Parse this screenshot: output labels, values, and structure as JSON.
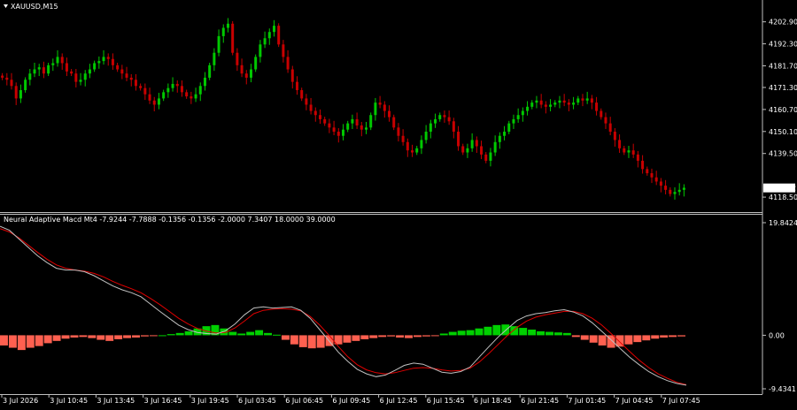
{
  "chart_data": [
    {
      "type": "candlestick",
      "title": "XAUUSD,M15",
      "ylim": [
        4113.0,
        4210.0
      ],
      "y_ticks": [
        "4202.90",
        "4192.30",
        "4181.70",
        "4171.30",
        "4160.70",
        "4150.10",
        "4139.50",
        "4118.50"
      ],
      "y_tick_values": [
        4202.9,
        4192.3,
        4181.7,
        4171.3,
        4160.7,
        4150.1,
        4139.5,
        4118.5
      ],
      "current_price": "4122.92",
      "current_price_value": 4122.92,
      "up_color": "#00c800",
      "down_color": "#c80000",
      "close_series": [
        4176,
        4175,
        4172,
        4166,
        4170,
        4175,
        4178,
        4180,
        4181,
        4178,
        4182,
        4183,
        4186,
        4183,
        4179,
        4178,
        4174,
        4175,
        4178,
        4180,
        4183,
        4184,
        4186,
        4185,
        4182,
        4180,
        4178,
        4176,
        4175,
        4172,
        4171,
        4168,
        4165,
        4163,
        4166,
        4169,
        4171,
        4173,
        4172,
        4169,
        4167,
        4166,
        4168,
        4172,
        4176,
        4182,
        4188,
        4196,
        4200,
        4202,
        4188,
        4182,
        4178,
        4176,
        4180,
        4186,
        4192,
        4195,
        4198,
        4201,
        4192,
        4186,
        4180,
        4174,
        4170,
        4166,
        4163,
        4160,
        4158,
        4156,
        4154,
        4152,
        4150,
        4148,
        4151,
        4154,
        4156,
        4153,
        4151,
        4152,
        4158,
        4164,
        4163,
        4160,
        4157,
        4152,
        4148,
        4145,
        4141,
        4140,
        4142,
        4146,
        4150,
        4154,
        4156,
        4158,
        4157,
        4155,
        4150,
        4143,
        4140,
        4142,
        4146,
        4143,
        4139,
        4136,
        4140,
        4145,
        4148,
        4150,
        4154,
        4156,
        4158,
        4160,
        4162,
        4164,
        4165,
        4163,
        4162,
        4163,
        4164,
        4165,
        4164,
        4163,
        4164,
        4166,
        4165,
        4166,
        4164,
        4160,
        4157,
        4154,
        4150,
        4146,
        4142,
        4140,
        4141,
        4139,
        4136,
        4132,
        4130,
        4128,
        4126,
        4124,
        4122,
        4120,
        4121,
        4122,
        4123
      ]
    },
    {
      "type": "line",
      "title": "Neural Adaptive Macd Mt4 -7.9244 -7.7888 -0.1356 -0.1356 -2.0000 7.3407 18.0000 39.0000",
      "ylim": [
        -9.4341,
        19.8424
      ],
      "y_ticks": [
        "19.8424",
        "0.00",
        "-9.4341"
      ],
      "y_tick_values": [
        19.8424,
        0.0,
        -9.4341
      ],
      "series": [
        {
          "name": "",
          "color": "#c0c0c0",
          "values": [
            19.2,
            18.5,
            17.0,
            15.5,
            14.0,
            12.8,
            11.8,
            11.5,
            11.5,
            11.2,
            10.5,
            9.6,
            8.7,
            8.0,
            7.5,
            6.8,
            5.5,
            4.2,
            3.0,
            1.8,
            1.0,
            0.5,
            0.3,
            0.2,
            0.8,
            2.0,
            3.6,
            4.8,
            5.0,
            4.8,
            4.9,
            5.0,
            4.4,
            3.0,
            1.0,
            -1.0,
            -3.0,
            -4.6,
            -6.0,
            -6.8,
            -7.3,
            -7.0,
            -6.2,
            -5.3,
            -4.9,
            -5.1,
            -5.8,
            -6.5,
            -6.7,
            -6.4,
            -5.6,
            -3.8,
            -2.0,
            -0.3,
            1.2,
            2.6,
            3.4,
            3.8,
            4.0,
            4.3,
            4.5,
            4.1,
            3.4,
            2.2,
            0.7,
            -0.8,
            -2.4,
            -3.9,
            -5.2,
            -6.4,
            -7.3,
            -8.0,
            -8.5,
            -8.8
          ]
        },
        {
          "name": "",
          "color": "#e00000",
          "values": [
            18.8,
            18.2,
            17.2,
            15.9,
            14.6,
            13.4,
            12.4,
            11.8,
            11.5,
            11.3,
            10.9,
            10.3,
            9.5,
            8.8,
            8.2,
            7.5,
            6.5,
            5.4,
            4.2,
            3.0,
            2.0,
            1.2,
            0.7,
            0.4,
            0.5,
            1.3,
            2.5,
            3.8,
            4.4,
            4.6,
            4.7,
            4.6,
            4.3,
            3.3,
            1.8,
            0.0,
            -2.0,
            -3.8,
            -5.2,
            -6.1,
            -6.6,
            -6.8,
            -6.6,
            -6.2,
            -5.8,
            -5.7,
            -5.8,
            -6.1,
            -6.3,
            -6.2,
            -5.8,
            -4.7,
            -3.2,
            -1.6,
            0.0,
            1.4,
            2.5,
            3.2,
            3.6,
            3.9,
            4.2,
            4.2,
            3.8,
            3.0,
            1.8,
            0.3,
            -1.3,
            -2.9,
            -4.4,
            -5.7,
            -6.8,
            -7.6,
            -8.3,
            -8.7
          ]
        },
        {
          "name": "",
          "type": "histogram",
          "up_color": "#00d000",
          "down_color": "#ff6050",
          "values": [
            -1.8,
            -2.2,
            -2.6,
            -2.2,
            -1.9,
            -1.4,
            -1.0,
            -0.6,
            -0.4,
            -0.3,
            -0.5,
            -0.8,
            -1.0,
            -0.7,
            -0.5,
            -0.4,
            -0.2,
            -0.1,
            0.0,
            0.2,
            0.4,
            0.7,
            1.2,
            1.6,
            1.8,
            1.2,
            0.6,
            0.3,
            0.6,
            0.9,
            0.4,
            0.1,
            -0.8,
            -1.6,
            -2.1,
            -2.3,
            -2.2,
            -1.9,
            -1.6,
            -1.3,
            -1.0,
            -0.7,
            -0.5,
            -0.3,
            -0.2,
            -0.4,
            -0.5,
            -0.3,
            -0.2,
            -0.1,
            0.3,
            0.6,
            0.8,
            0.9,
            1.2,
            1.5,
            1.8,
            1.9,
            1.6,
            1.3,
            1.0,
            0.7,
            0.6,
            0.5,
            0.4,
            -0.3,
            -0.8,
            -1.3,
            -1.8,
            -2.2,
            -2.0,
            -1.6,
            -1.2,
            -0.9,
            -0.6,
            -0.4,
            -0.3,
            -0.2
          ]
        }
      ]
    }
  ],
  "x_ticks": [
    "3 Jul 2026",
    "3 Jul 10:45",
    "3 Jul 13:45",
    "3 Jul 16:45",
    "3 Jul 19:45",
    "6 Jul 03:45",
    "6 Jul 06:45",
    "6 Jul 09:45",
    "6 Jul 12:45",
    "6 Jul 15:45",
    "6 Jul 18:45",
    "6 Jul 21:45",
    "7 Jul 01:45",
    "7 Jul 04:45",
    "7 Jul 07:45"
  ]
}
